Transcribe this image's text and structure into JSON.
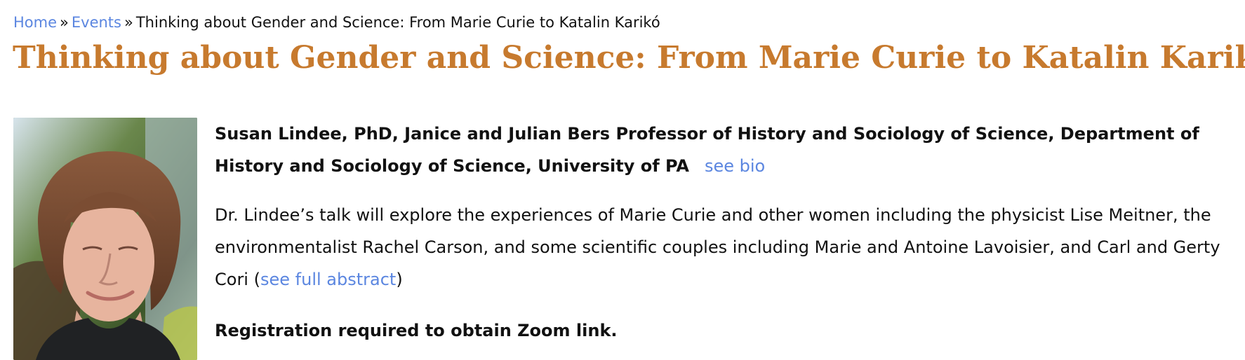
{
  "breadcrumb": {
    "home": "Home",
    "separator": "»",
    "events": "Events",
    "current": "Thinking about Gender and Science: From Marie Curie to Katalin Karikó"
  },
  "page": {
    "title": "Thinking about Gender and Science: From Marie Curie to Katalin Karikó"
  },
  "speaker": {
    "text": "Susan Lindee, PhD, Janice and Julian Bers Professor of History and Sociology of Science, Department of History and Sociology of Science, University of PA",
    "bio_link": "see bio"
  },
  "abstract": {
    "text": "Dr. Lindee’s talk will explore the experiences of Marie Curie and other women including the physicist Lise Meitner, the environmentalist Rachel Carson, and some scientific couples including Marie and Antoine Lavoisier, and Carl and Gerty Cori",
    "open_paren": "(",
    "link": "see full abstract",
    "close_paren": ")"
  },
  "registration": {
    "text": "Registration required to obtain Zoom link."
  },
  "colors": {
    "link": "#5b86e0",
    "title": "#c77a2e",
    "text": "#111111"
  },
  "icons": {
    "portrait": "speaker-photo"
  }
}
